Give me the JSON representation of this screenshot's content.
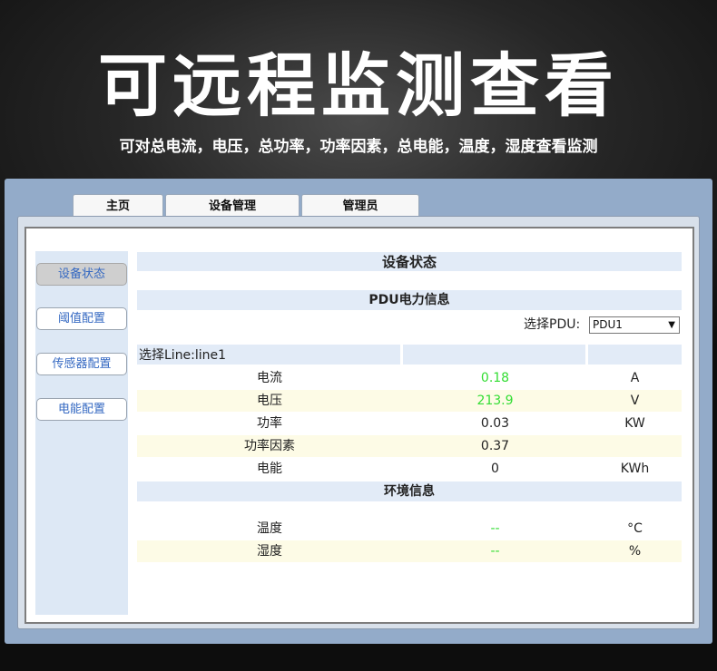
{
  "banner": {
    "title": "可远程监测查看",
    "subtitle": "可对总电流，电压，总功率，功率因素，总电能，温度，湿度查看监测"
  },
  "tabs": [
    {
      "label": "主页"
    },
    {
      "label": "设备管理"
    },
    {
      "label": "管理员"
    }
  ],
  "sidebar": {
    "items": [
      {
        "label": "设备状态",
        "active": true
      },
      {
        "label": "阈值配置",
        "active": false
      },
      {
        "label": "传感器配置",
        "active": false
      },
      {
        "label": "电能配置",
        "active": false
      }
    ]
  },
  "main": {
    "title": "设备状态",
    "pdu_section": "PDU电力信息",
    "pdu_select_label": "选择PDU:",
    "pdu_select_value": "PDU1",
    "line_label": "选择Line:line1",
    "power_rows": [
      {
        "name": "电流",
        "value": "0.18",
        "unit": "A",
        "highlight": true
      },
      {
        "name": "电压",
        "value": "213.9",
        "unit": "V",
        "highlight": true
      },
      {
        "name": "功率",
        "value": "0.03",
        "unit": "KW",
        "highlight": false
      },
      {
        "name": "功率因素",
        "value": "0.37",
        "unit": "",
        "highlight": false
      },
      {
        "name": "电能",
        "value": "0",
        "unit": "KWh",
        "highlight": false
      }
    ],
    "env_section": "环境信息",
    "env_rows": [
      {
        "name": "温度",
        "value": "--",
        "unit": "°C",
        "highlight": true
      },
      {
        "name": "湿度",
        "value": "--",
        "unit": "%",
        "highlight": true
      }
    ]
  },
  "colors": {
    "frame": "#93abc9",
    "header_bar": "#e2ebf7",
    "alt_row": "#fdfbe6",
    "value_green": "#33dd33",
    "sidebar_link": "#3569c2"
  }
}
